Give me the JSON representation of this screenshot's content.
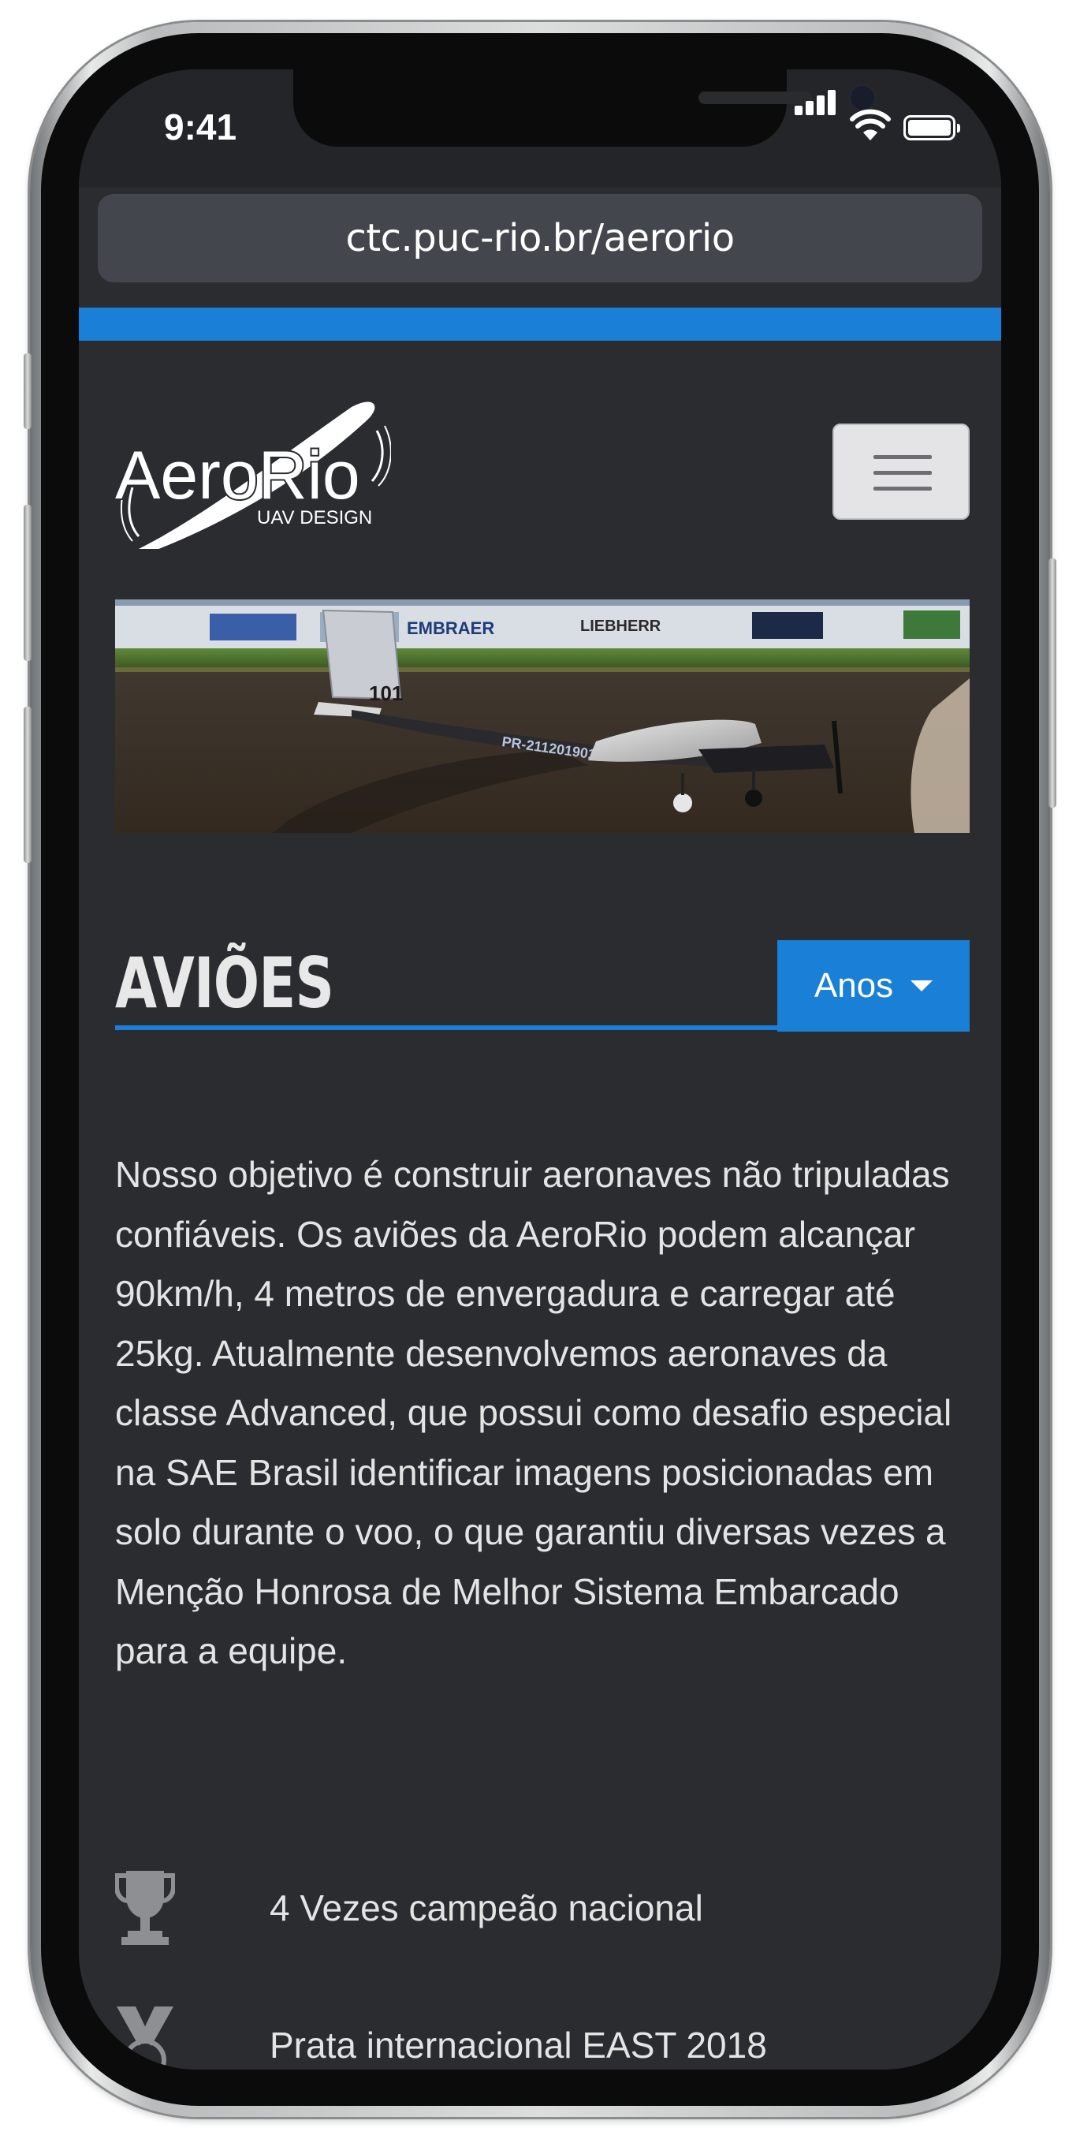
{
  "status_bar": {
    "time": "9:41"
  },
  "browser": {
    "url": "ctc.puc-rio.br/aerorio"
  },
  "header": {
    "logo_text": "AeroRio",
    "logo_subtext": "UAV DESIGN",
    "menu_icon": "hamburger-icon"
  },
  "banner": {
    "image": "aircraft-photo",
    "aircraft_tail_number": "101",
    "aircraft_registration": "PR-211201901",
    "sponsor_labels": [
      "EMBRAER",
      "LIEBHERR"
    ]
  },
  "section": {
    "title": "AVIÕES",
    "filter_button_label": "Anos"
  },
  "description": "Nosso objetivo é construir aeronaves não tripuladas confiáveis. Os aviões da AeroRio podem alcançar 90km/h, 4 metros de envergadura e carregar até 25kg. Atualmente desenvolvemos aeronaves da classe Advanced, que possui como desafio especial na SAE Brasil identificar imagens posicionadas em solo durante o voo, o que garantiu diversas vezes a Menção Honrosa de Melhor Sistema Embarcado para a equipe.",
  "awards": [
    {
      "icon": "trophy-icon",
      "label": "4 Vezes campeão nacional"
    },
    {
      "icon": "medal-icon",
      "label": "Prata internacional EAST 2018"
    }
  ],
  "colors": {
    "accent": "#1a7fd6",
    "page_background": "#2b2c30",
    "text": "#e4e4e4"
  }
}
